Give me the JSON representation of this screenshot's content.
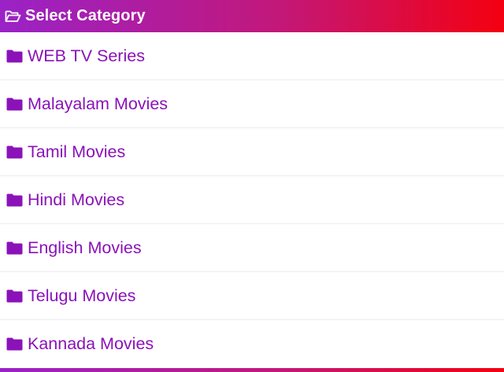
{
  "header": {
    "title": "Select Category",
    "icon": "folder-open-icon",
    "gradient_start": "#9a22c7",
    "gradient_end": "#f40010"
  },
  "categories": [
    {
      "label": "WEB TV Series",
      "icon": "folder-icon"
    },
    {
      "label": "Malayalam Movies",
      "icon": "folder-icon"
    },
    {
      "label": "Tamil Movies",
      "icon": "folder-icon"
    },
    {
      "label": "Hindi Movies",
      "icon": "folder-icon"
    },
    {
      "label": "English Movies",
      "icon": "folder-icon"
    },
    {
      "label": "Telugu Movies",
      "icon": "folder-icon"
    },
    {
      "label": "Kannada Movies",
      "icon": "folder-icon"
    }
  ],
  "colors": {
    "item_text": "#8a12b8",
    "divider": "#ececec"
  }
}
